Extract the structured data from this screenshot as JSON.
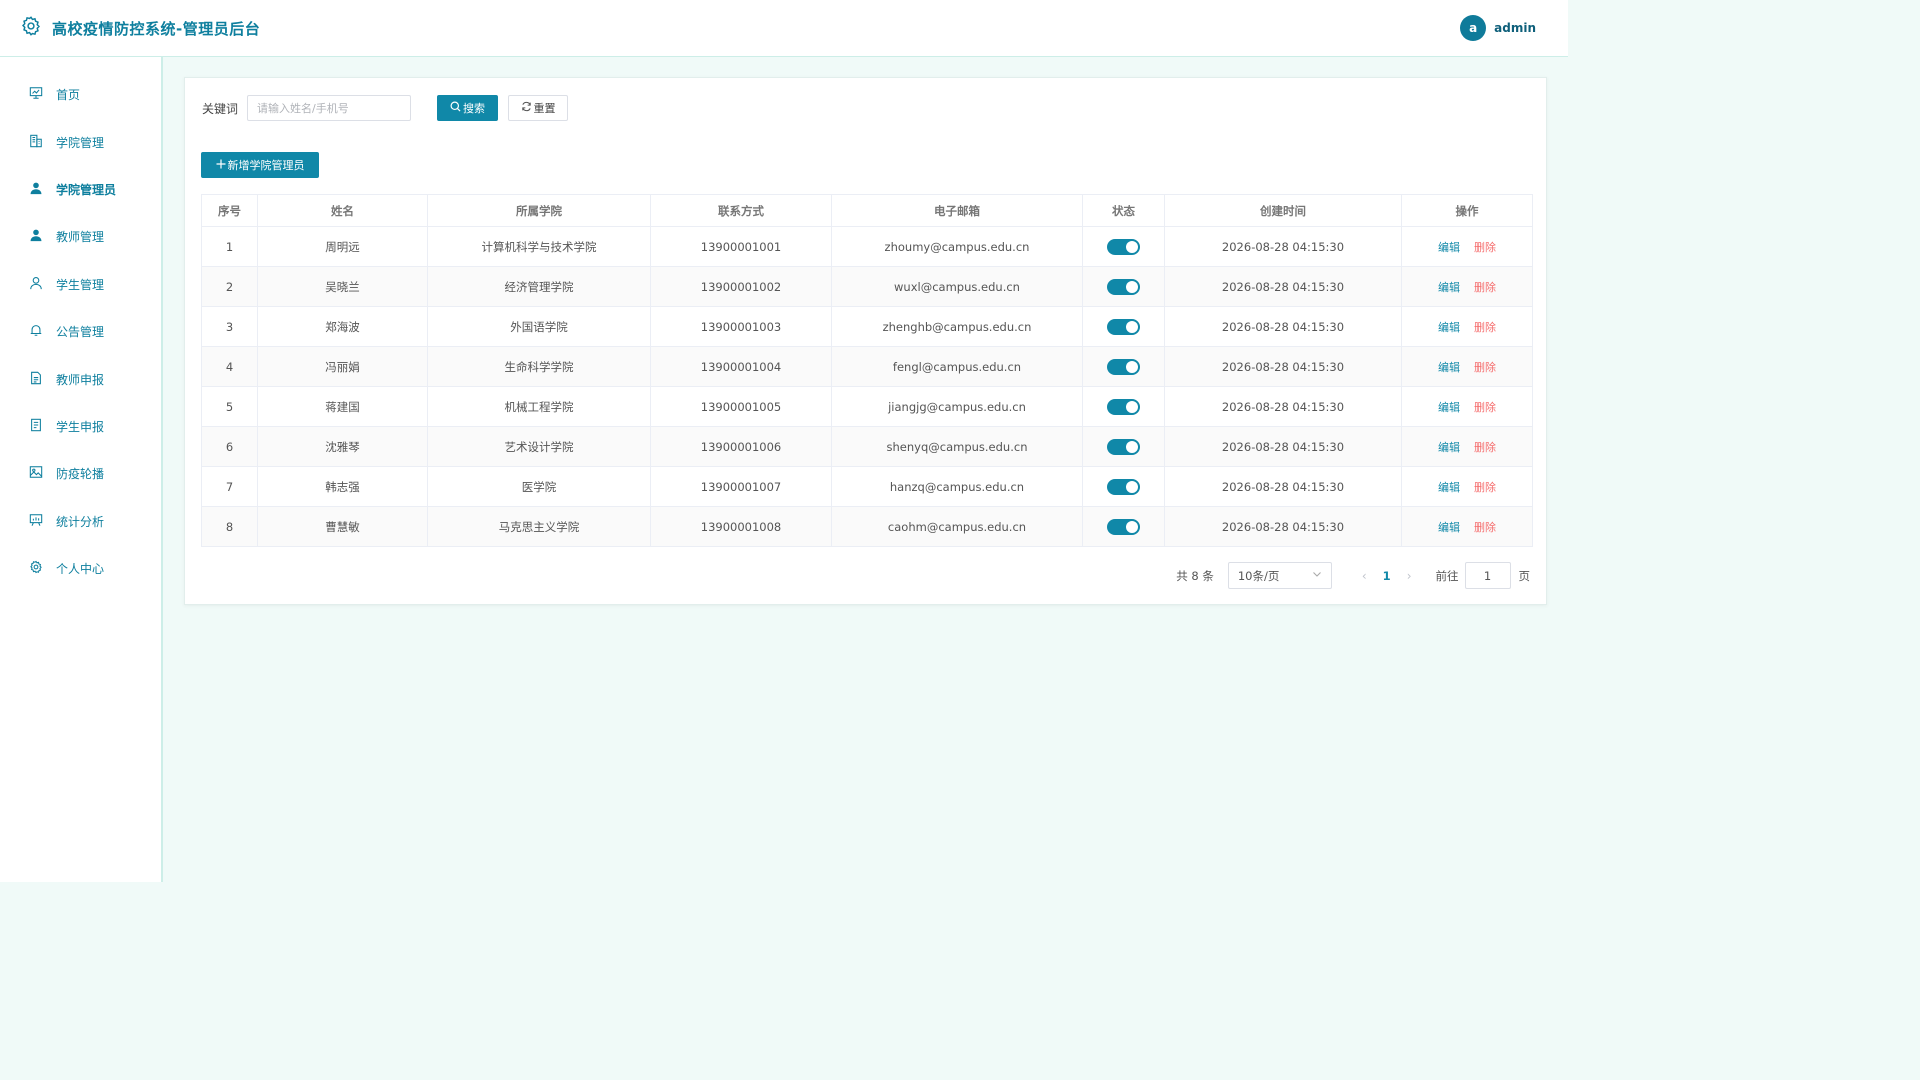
{
  "header": {
    "title": "高校疫情防控系统-管理员后台",
    "avatar_letter": "a",
    "username": "admin"
  },
  "sidebar": {
    "items": [
      {
        "label": "首页",
        "icon": "presentation-icon",
        "name": "sidebar-item-home"
      },
      {
        "label": "学院管理",
        "icon": "building-icon",
        "name": "sidebar-item-college"
      },
      {
        "label": "学院管理员",
        "icon": "user-filled-icon",
        "name": "sidebar-item-college-admin",
        "active": true
      },
      {
        "label": "教师管理",
        "icon": "user-filled-icon",
        "name": "sidebar-item-teacher"
      },
      {
        "label": "学生管理",
        "icon": "user-outline-icon",
        "name": "sidebar-item-student"
      },
      {
        "label": "公告管理",
        "icon": "bell-icon",
        "name": "sidebar-item-notice"
      },
      {
        "label": "教师申报",
        "icon": "document-icon",
        "name": "sidebar-item-teacher-report"
      },
      {
        "label": "学生申报",
        "icon": "tickets-icon",
        "name": "sidebar-item-student-report"
      },
      {
        "label": "防疫轮播",
        "icon": "picture-icon",
        "name": "sidebar-item-carousel"
      },
      {
        "label": "统计分析",
        "icon": "data-board-icon",
        "name": "sidebar-item-statistics"
      },
      {
        "label": "个人中心",
        "icon": "gear-icon",
        "name": "sidebar-item-profile"
      }
    ]
  },
  "search": {
    "label": "关键词",
    "placeholder": "请输入姓名/手机号",
    "value": "",
    "search_label": "搜索",
    "reset_label": "重置"
  },
  "toolbar": {
    "add_label": "新增学院管理员"
  },
  "table": {
    "columns": [
      "序号",
      "姓名",
      "所属学院",
      "联系方式",
      "电子邮箱",
      "状态",
      "创建时间",
      "操作"
    ],
    "edit_label": "编辑",
    "delete_label": "删除",
    "rows": [
      {
        "no": "1",
        "name": "周明远",
        "college": "计算机科学与技术学院",
        "phone": "13900001001",
        "email": "zhoumy@campus.edu.cn",
        "enabled": true,
        "created": "2026-08-28 04:15:30"
      },
      {
        "no": "2",
        "name": "吴晓兰",
        "college": "经济管理学院",
        "phone": "13900001002",
        "email": "wuxl@campus.edu.cn",
        "enabled": true,
        "created": "2026-08-28 04:15:30"
      },
      {
        "no": "3",
        "name": "郑海波",
        "college": "外国语学院",
        "phone": "13900001003",
        "email": "zhenghb@campus.edu.cn",
        "enabled": true,
        "created": "2026-08-28 04:15:30"
      },
      {
        "no": "4",
        "name": "冯丽娟",
        "college": "生命科学学院",
        "phone": "13900001004",
        "email": "fengl@campus.edu.cn",
        "enabled": true,
        "created": "2026-08-28 04:15:30"
      },
      {
        "no": "5",
        "name": "蒋建国",
        "college": "机械工程学院",
        "phone": "13900001005",
        "email": "jiangjg@campus.edu.cn",
        "enabled": true,
        "created": "2026-08-28 04:15:30"
      },
      {
        "no": "6",
        "name": "沈雅琴",
        "college": "艺术设计学院",
        "phone": "13900001006",
        "email": "shenyq@campus.edu.cn",
        "enabled": true,
        "created": "2026-08-28 04:15:30"
      },
      {
        "no": "7",
        "name": "韩志强",
        "college": "医学院",
        "phone": "13900001007",
        "email": "hanzq@campus.edu.cn",
        "enabled": true,
        "created": "2026-08-28 04:15:30"
      },
      {
        "no": "8",
        "name": "曹慧敏",
        "college": "马克思主义学院",
        "phone": "13900001008",
        "email": "caohm@campus.edu.cn",
        "enabled": true,
        "created": "2026-08-28 04:15:30"
      }
    ]
  },
  "pagination": {
    "total_text": "共 8 条",
    "page_size": "10条/页",
    "current_page": "1",
    "goto_label": "前往",
    "goto_value": "1",
    "unit_label": "页"
  },
  "colors": {
    "accent": "#1088a8",
    "danger": "#f56c6c",
    "background": "#f0faf8"
  }
}
